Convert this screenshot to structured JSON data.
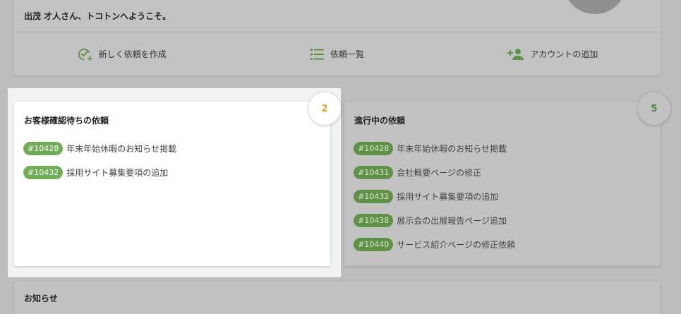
{
  "welcome": {
    "text": "出茂 才人さん、トコトンへようこそ。"
  },
  "actions": [
    {
      "label": "新しく依頼を作成",
      "icon": "check-add-icon"
    },
    {
      "label": "依頼一覧",
      "icon": "list-icon"
    },
    {
      "label": "アカウントの追加",
      "icon": "person-add-icon"
    }
  ],
  "awaiting": {
    "title": "お客様確認待ちの依頼",
    "count": "2",
    "items": [
      {
        "id": "#10428",
        "title": "年末年始休暇のお知らせ掲載"
      },
      {
        "id": "#10432",
        "title": "採用サイト募集要項の追加"
      }
    ]
  },
  "in_progress": {
    "title": "進行中の依頼",
    "count": "5",
    "items": [
      {
        "id": "#10428",
        "title": "年末年始休暇のお知らせ掲載"
      },
      {
        "id": "#10431",
        "title": "会社概要ページの修正"
      },
      {
        "id": "#10432",
        "title": "採用サイト募集要項の追加"
      },
      {
        "id": "#10438",
        "title": "展示会の出展報告ページ追加"
      },
      {
        "id": "#10440",
        "title": "サービス紹介ページの修正依頼"
      }
    ]
  },
  "news": {
    "title": "お知らせ"
  },
  "colors": {
    "accent_green": "#71ad59",
    "count_orange": "#f0a030",
    "count_dim_green": "#4f8a3c"
  }
}
